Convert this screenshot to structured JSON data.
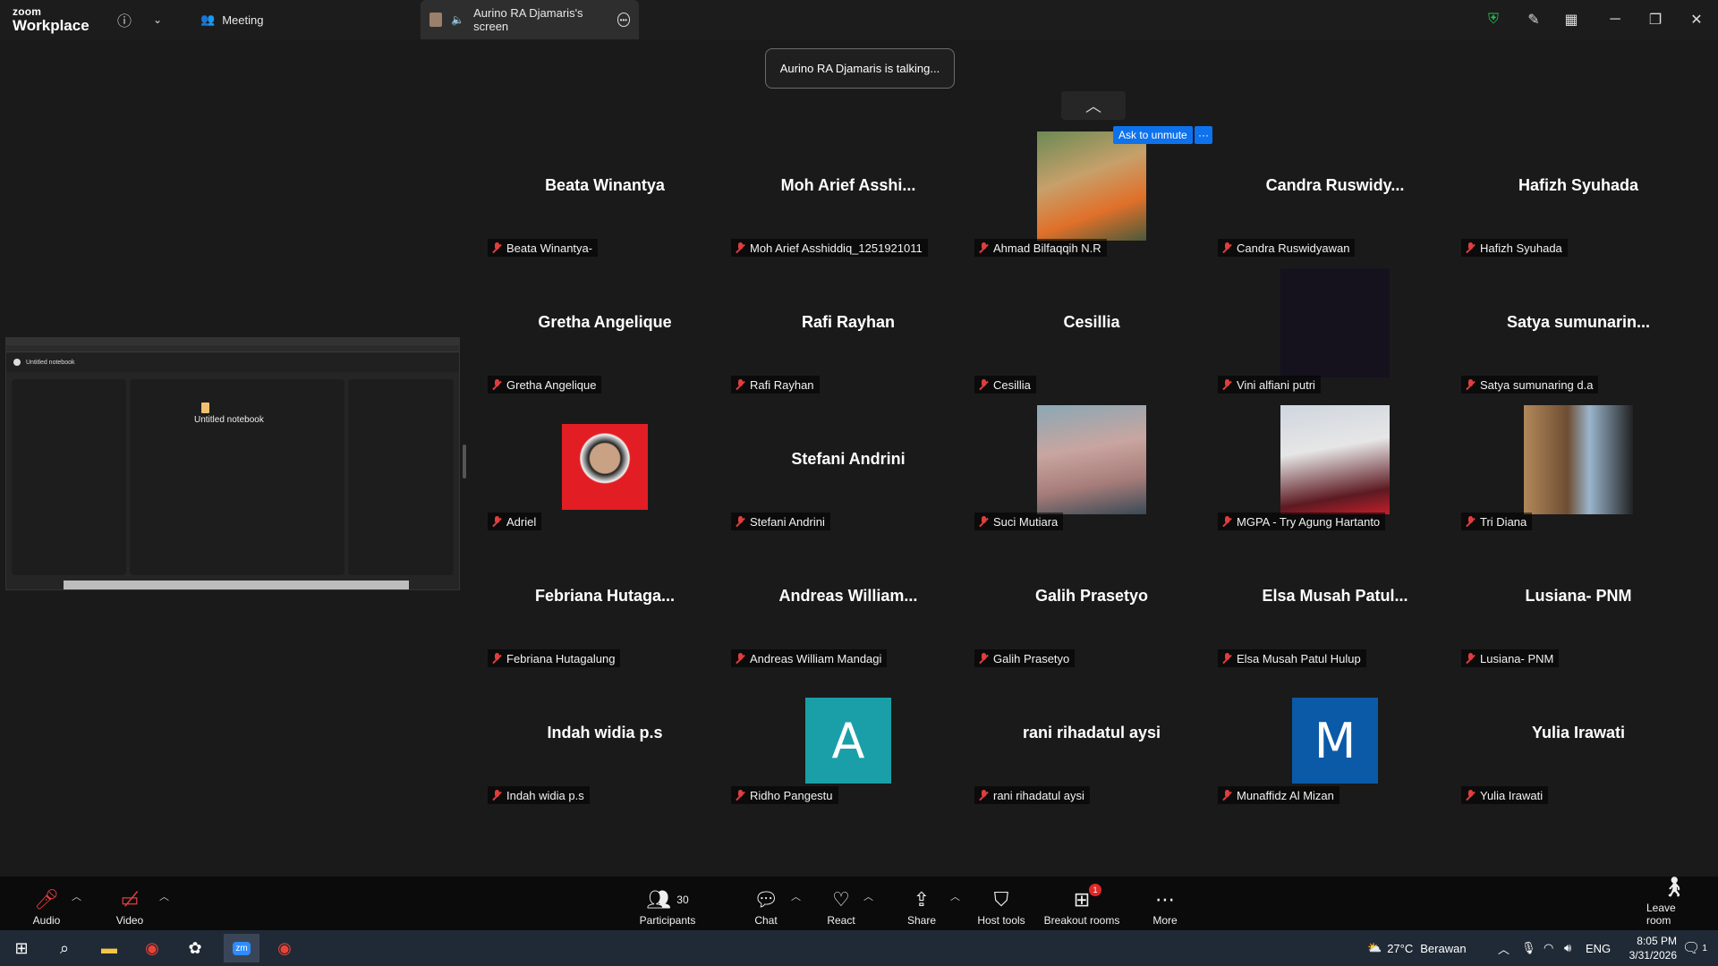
{
  "app": {
    "brand_top": "zoom",
    "brand_bottom": "Workplace"
  },
  "titlebar": {
    "meeting_tab": "Meeting",
    "screen_tab": "Aurino RA Djamaris's screen"
  },
  "stage": {
    "talking_toast": "Aurino RA Djamaris is talking...",
    "ask_to_unmute": "Ask to unmute",
    "more_options": "···",
    "shared_screen": {
      "notebook_title": "Untitled notebook",
      "doc_title": "Untitled notebook"
    }
  },
  "participants": [
    {
      "big": "Beata Winantya",
      "label": "Beata Winantya-"
    },
    {
      "big": "Moh Arief Asshi...",
      "label": "Moh Arief Asshiddiq_1251921011"
    },
    {
      "big": "",
      "label": "Ahmad Bilfaqqih N.R",
      "photo": "worker-photo"
    },
    {
      "big": "Candra Ruswidy...",
      "label": "Candra Ruswidyawan"
    },
    {
      "big": "Hafizh Syuhada",
      "label": "Hafizh Syuhada"
    },
    {
      "big": "Gretha Angelique",
      "label": "Gretha Angelique"
    },
    {
      "big": "Rafi Rayhan",
      "label": "Rafi Rayhan"
    },
    {
      "big": "Cesillia",
      "label": "Cesillia"
    },
    {
      "big": "",
      "label": "Vini alfiani putri",
      "photo": "dark-video"
    },
    {
      "big": "Satya sumunarin...",
      "label": "Satya sumunaring d.a"
    },
    {
      "big": "",
      "label": "Adriel",
      "photo": "red-portrait"
    },
    {
      "big": "Stefani Andrini",
      "label": "Stefani Andrini"
    },
    {
      "big": "",
      "label": "Suci Mutiara",
      "photo": "hijab-portrait"
    },
    {
      "big": "",
      "label": "MGPA - Try Agung Hartanto",
      "photo": "presenter-photo"
    },
    {
      "big": "",
      "label": "Tri Diana",
      "photo": "desk-photo"
    },
    {
      "big": "Febriana Hutaga...",
      "label": "Febriana Hutagalung"
    },
    {
      "big": "Andreas William...",
      "label": "Andreas William Mandagi"
    },
    {
      "big": "Galih Prasetyo",
      "label": "Galih Prasetyo"
    },
    {
      "big": "Elsa Musah Patul...",
      "label": "Elsa Musah Patul Hulup"
    },
    {
      "big": "Lusiana- PNM",
      "label": "Lusiana- PNM"
    },
    {
      "big": "Indah widia p.s",
      "label": "Indah widia p.s"
    },
    {
      "big": "",
      "label": "Ridho Pangestu",
      "avatar": "A",
      "avatar_color": "#1a9fa8"
    },
    {
      "big": "rani rihadatul aysi",
      "label": "rani rihadatul aysi"
    },
    {
      "big": "",
      "label": "Munaffidz Al Mizan",
      "avatar": "M",
      "avatar_color": "#0b5aa8"
    },
    {
      "big": "Yulia Irawati",
      "label": "Yulia Irawati"
    }
  ],
  "toolbar": {
    "audio": "Audio",
    "video": "Video",
    "participants": "Participants",
    "participants_count": "30",
    "chat": "Chat",
    "react": "React",
    "share": "Share",
    "host_tools": "Host tools",
    "breakout_rooms": "Breakout rooms",
    "breakout_badge": "1",
    "more": "More",
    "leave_room": "Leave room"
  },
  "taskbar": {
    "temperature": "27°C",
    "weather": "Berawan",
    "language": "ENG",
    "time": "8:05 PM",
    "date": "3/31/2026",
    "notification_count": "1"
  },
  "colors": {
    "unmute_blue": "#0e72ed",
    "mute_red": "#e03e3e",
    "bg": "#1a1a1a"
  }
}
